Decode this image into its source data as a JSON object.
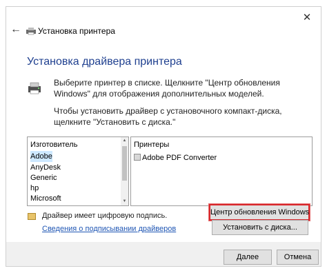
{
  "window": {
    "close_icon": "close-icon",
    "back_icon": "back-arrow-icon",
    "title": "Установка принтера"
  },
  "main": {
    "heading": "Установка драйвера принтера",
    "description_1": "Выберите принтер в списке. Щелкните \"Центр обновления Windows\" для отображения дополнительных моделей.",
    "description_2": "Чтобы установить драйвер с установочного компакт-диска, щелкните \"Установить с диска.\""
  },
  "manufacturers": {
    "header": "Изготовитель",
    "items": [
      "Adobe",
      "AnyDesk",
      "Generic",
      "hp",
      "Microsoft"
    ],
    "selected": "Adobe"
  },
  "printers": {
    "header": "Принтеры",
    "items": [
      "Adobe PDF Converter"
    ]
  },
  "signature": {
    "text": "Драйвер имеет цифровую подпись.",
    "link": "Сведения о подписывании драйверов"
  },
  "buttons": {
    "windows_update": "Центр обновления Windows",
    "have_disk": "Установить с диска...",
    "next": "Далее",
    "cancel": "Отмена"
  },
  "colors": {
    "heading": "#1e3f8f",
    "link": "#1f56b4",
    "highlight_border": "#d8272b",
    "selection": "#cde8ff"
  }
}
